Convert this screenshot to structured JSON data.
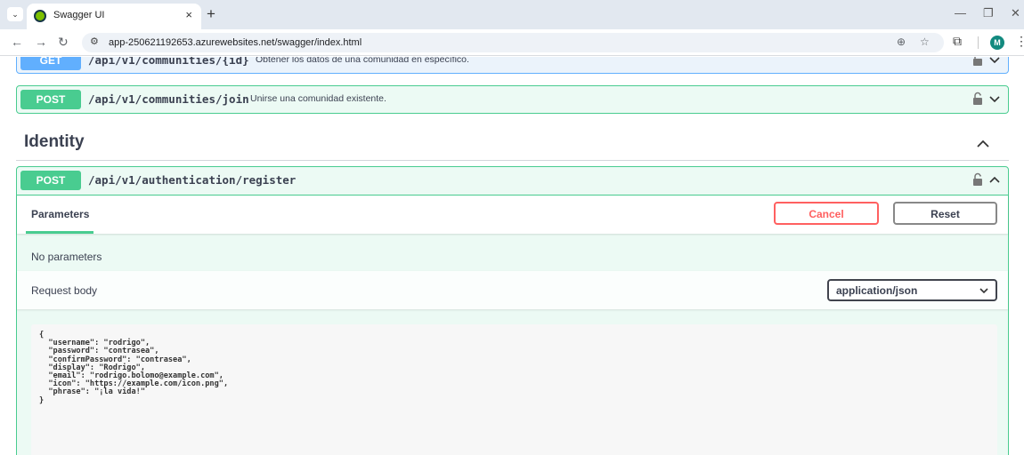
{
  "browser": {
    "tab_title": "Swagger UI",
    "tab_close": "×",
    "new_tab": "+",
    "minimize": "—",
    "restore": "❐",
    "close": "✕",
    "url": "app-250621192653.azurewebsites.net/swagger/index.html",
    "profile_initial": "M",
    "icons": [
      "tab-search-icon",
      "swagger-favicon",
      "back-icon",
      "forward-icon",
      "reload-icon",
      "site-settings-icon",
      "zoom-icon",
      "bookmark-star-icon",
      "extensions-icon",
      "profile-avatar",
      "menu-kebab-icon"
    ]
  },
  "endpoints_above": [
    {
      "method": "GET",
      "path": "/api/v1/communities/{id}",
      "summary": "Obtener los datos de una comunidad en específico."
    },
    {
      "method": "POST",
      "path": "/api/v1/communities/join",
      "summary": "Unirse una comunidad existente."
    }
  ],
  "section": {
    "title": "Identity"
  },
  "open_endpoint": {
    "method": "POST",
    "path": "/api/v1/authentication/register",
    "parameters_tab": "Parameters",
    "cancel_label": "Cancel",
    "reset_label": "Reset",
    "no_parameters": "No parameters",
    "request_body_label": "Request body",
    "content_type": "application/json",
    "body": "{\n  \"username\": \"rodrigo\",\n  \"password\": \"contrasea\",\n  \"confirmPassword\": \"contrasea\",\n  \"display\": \"Rodrigo\",\n  \"email\": \"rodrigo.bolomo@example.com\",\n  \"icon\": \"https://example.com/icon.png\",\n  \"phrase\": \"¡la vida!\"\n}"
  },
  "colors": {
    "get": "#61affe",
    "post": "#49cc90",
    "cancel": "#ff6060"
  }
}
